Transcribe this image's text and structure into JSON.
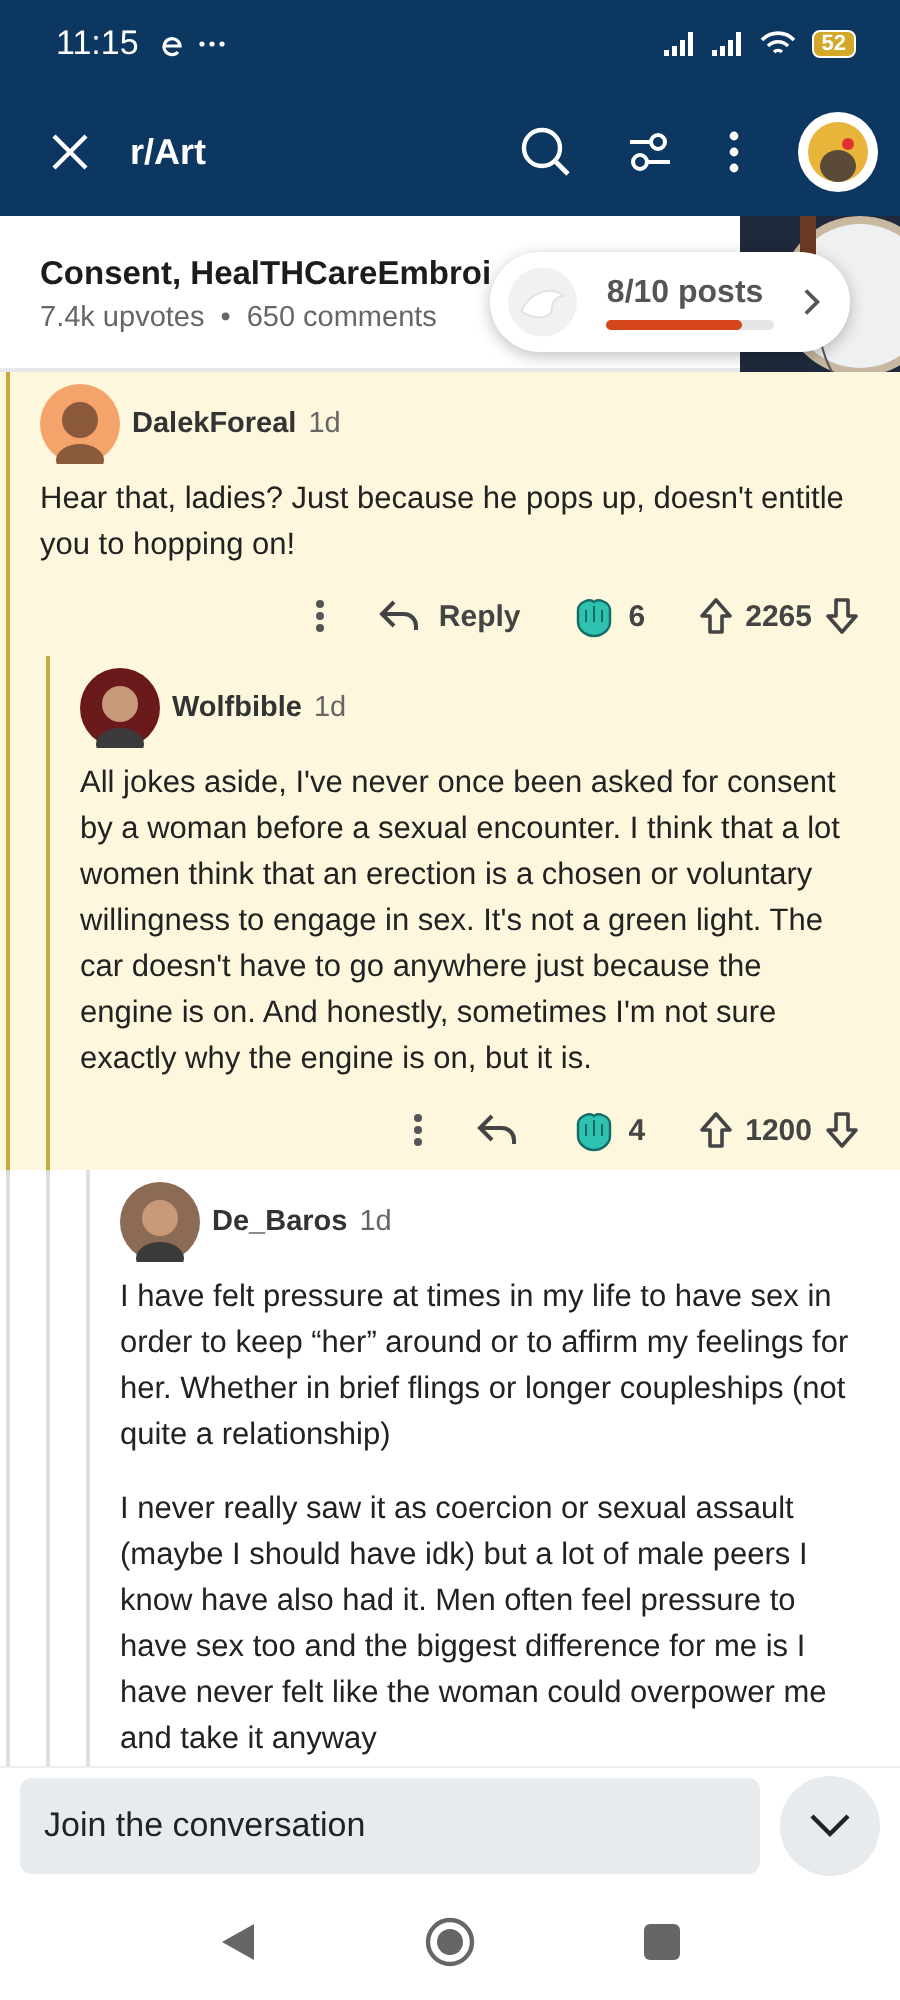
{
  "status_bar": {
    "time": "11:15",
    "battery": "52"
  },
  "toolbar": {
    "title": "r/Art"
  },
  "post": {
    "title": "Consent, HealTHCareEmbroi",
    "upvotes": "7.4k upvotes",
    "separator": "•",
    "comments": "650 comments",
    "kind": "picture"
  },
  "progress": {
    "label": "8/10 posts",
    "level": 0.8
  },
  "comments": [
    {
      "author": "DalekForeal",
      "age": "1d",
      "highlighted": true,
      "body": "Hear that, ladies? Just because he pops up, doesn't entitle you to hopping on!",
      "reply_label": "Reply",
      "award_count": "6",
      "score": "2265",
      "children": [
        {
          "author": "Wolfbible",
          "age": "1d",
          "highlighted": true,
          "body": "All jokes aside, I've never once been asked for consent by a woman before a sexual encounter. I think that a lot women think that an erection is a chosen or voluntary willingness to engage in sex. It's not a green light. The car doesn't have to go anywhere just because the engine is on. And honestly, sometimes I'm not sure exactly why the engine is on, but it is.",
          "award_count": "4",
          "score": "1200",
          "children": [
            {
              "author": "De_Baros",
              "age": "1d",
              "highlighted": false,
              "paragraphs": [
                "I have felt pressure at times in my life to have sex in order to keep “her” around or to affirm my feelings for her. Whether in brief flings or longer coupleships (not quite a relationship)",
                "I never really saw it as coercion or sexual assault (maybe I should have idk) but a lot of male peers I know have also had it. Men often feel pressure to have sex too and the biggest difference for me is I have never felt like the woman could overpower me and take it anyway"
              ]
            }
          ]
        }
      ]
    }
  ],
  "composer": {
    "placeholder": "Join the conversation"
  }
}
